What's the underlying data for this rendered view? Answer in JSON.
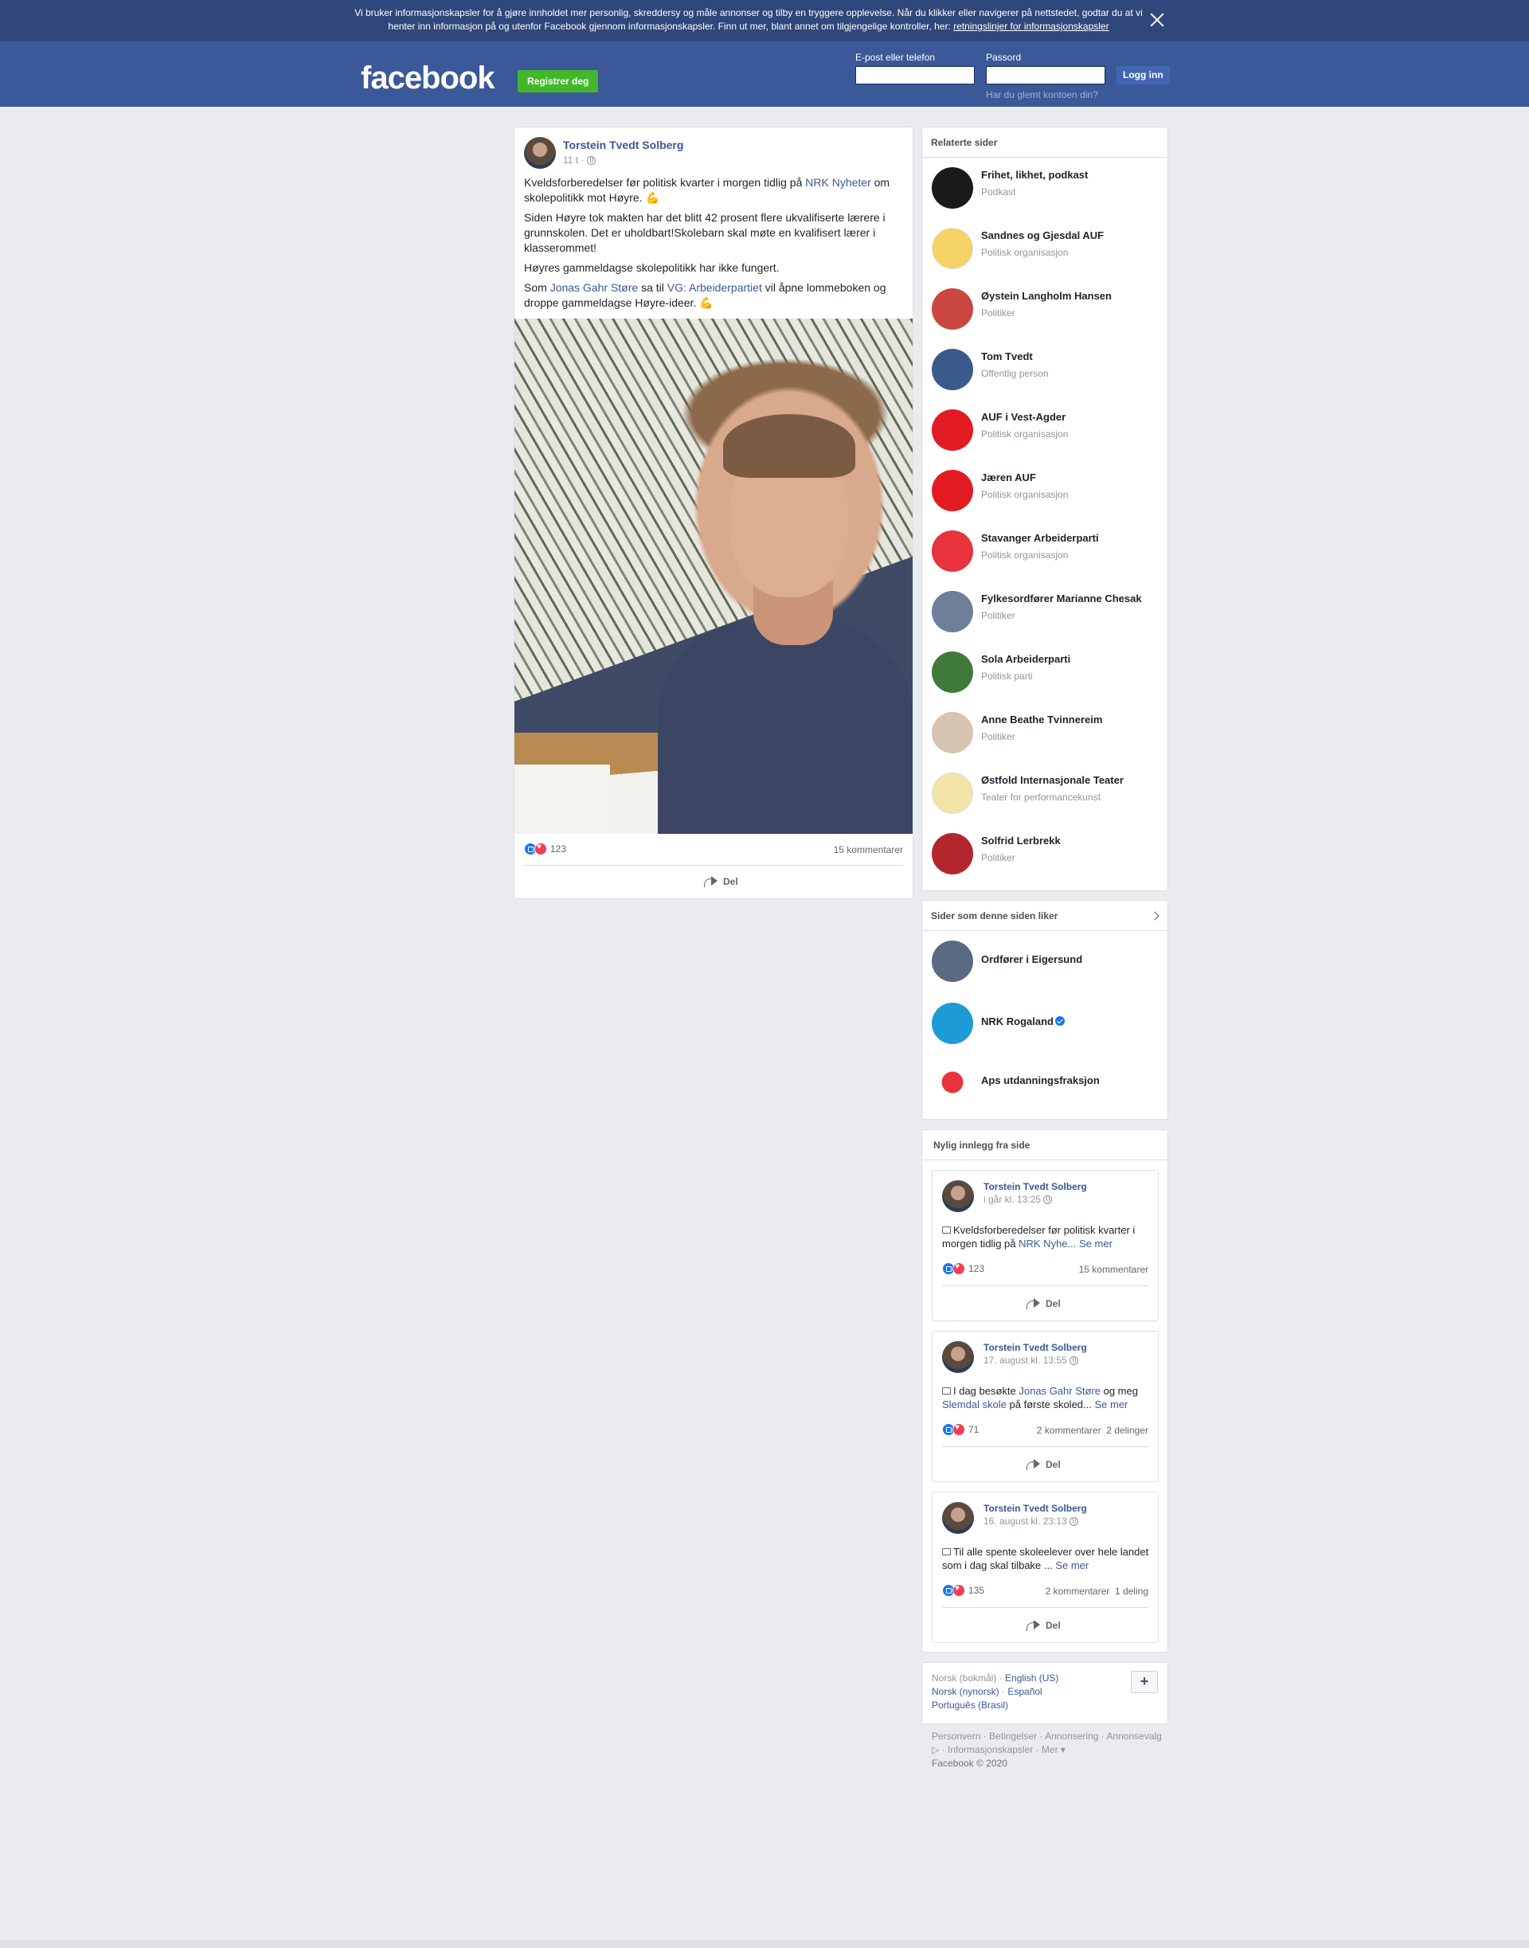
{
  "cookie_banner": {
    "text": "Vi bruker informasjonskapsler for å gjøre innholdet mer personlig, skreddersy og måle annonser og tilby en tryggere opplevelse. Når du klikker eller navigerer på nettstedet, godtar du at vi henter inn informasjon på og utenfor Facebook gjennom informasjonskapsler. Finn ut mer, blant annet om tilgjengelige kontroller, her: ",
    "link": "retningslinjer for informasjonskapsler"
  },
  "header": {
    "logo": "facebook",
    "register": "Registrer deg",
    "email_label": "E-post eller telefon",
    "password_label": "Passord",
    "login": "Logg inn",
    "forgot": "Har du glemt kontoen din?"
  },
  "post": {
    "author": "Torstein Tvedt Solberg",
    "time": "11 t ·",
    "p1_a": "Kveldsforberedelser før politisk kvarter i morgen tidlig på ",
    "p1_link": "NRK Nyheter",
    "p1_b": " om skolepolitikk mot Høyre. 💪",
    "p2": "Siden Høyre tok makten har det blitt 42 prosent flere ukvalifiserte lærere i grunnskolen. Det er uholdbart!Skolebarn skal møte en kvalifisert lærer i klasserommet!",
    "p3": "Høyres gammeldagse skolepolitikk har ikke fungert.",
    "p4_a": "Som ",
    "p4_link1": "Jonas Gahr Støre",
    "p4_b": " sa til ",
    "p4_link2": "VG: Arbeiderpartiet",
    "p4_c": " vil åpne lommeboken og droppe gammeldagse Høyre-ideer. 💪",
    "reactions": "123",
    "comments": "15 kommentarer",
    "share": "Del"
  },
  "related": {
    "title": "Relaterte sider",
    "items": [
      {
        "name": "Frihet, likhet, podkast",
        "category": "Podkast",
        "color": "#1a1a1a"
      },
      {
        "name": "Sandnes og Gjesdal AUF",
        "category": "Politisk organisasjon",
        "color": "#f6d365"
      },
      {
        "name": "Øystein Langholm Hansen",
        "category": "Politiker",
        "color": "#c9473f"
      },
      {
        "name": "Tom Tvedt",
        "category": "Offentlig person",
        "color": "#3b5a8c"
      },
      {
        "name": "AUF i Vest-Agder",
        "category": "Politisk organisasjon",
        "color": "#e21b23"
      },
      {
        "name": "Jæren AUF",
        "category": "Politisk organisasjon",
        "color": "#e21b23"
      },
      {
        "name": "Stavanger Arbeiderparti",
        "category": "Politisk organisasjon",
        "color": "#e8323c"
      },
      {
        "name": "Fylkesordfører Marianne Chesak",
        "category": "Politiker",
        "color": "#6d7f99"
      },
      {
        "name": "Sola Arbeiderparti",
        "category": "Politisk parti",
        "color": "#3f7a3a"
      },
      {
        "name": "Anne Beathe Tvinnereim",
        "category": "Politiker",
        "color": "#d6c3b0"
      },
      {
        "name": "Østfold Internasjonale Teater",
        "category": "Teater for performancekunst",
        "color": "#f3e3a6"
      },
      {
        "name": "Solfrid Lerbrekk",
        "category": "Politiker",
        "color": "#b3262e"
      }
    ]
  },
  "likes": {
    "title": "Sider som denne siden liker",
    "items": [
      {
        "name": "Ordfører i Eigersund",
        "color": "#5a6a80"
      },
      {
        "name": "NRK Rogaland",
        "color": "#1e9ad6"
      },
      {
        "name": "Aps utdanningsfraksjon",
        "color": "#ffffff"
      }
    ]
  },
  "recent": {
    "title": "Nylig innlegg fra side",
    "posts": [
      {
        "author": "Torstein Tvedt Solberg",
        "date": "i går kl. 13:25",
        "text_a": "Kveldsforberedelser før politisk kvarter i morgen tidlig på ",
        "link1": "NRK Nyhe...",
        "text_b": " ",
        "link2": "",
        "text_c": "",
        "more": "Se mer",
        "reactions": "123",
        "comments": "15 kommentarer",
        "shares": "",
        "share": "Del"
      },
      {
        "author": "Torstein Tvedt Solberg",
        "date": "17. august kl. 13:55",
        "text_a": "I dag besøkte ",
        "link1": "Jonas Gahr Støre",
        "text_b": " og meg ",
        "link2": "Slemdal skole",
        "text_c": " på første skoled... ",
        "more": "Se mer",
        "reactions": "71",
        "comments": "2 kommentarer",
        "shares": "2 delinger",
        "share": "Del"
      },
      {
        "author": "Torstein Tvedt Solberg",
        "date": "16. august kl. 23:13",
        "text_a": "Til alle spente skoleelever over hele landet som i dag skal tilbake ... ",
        "link1": "",
        "text_b": "",
        "link2": "",
        "text_c": "",
        "more": "Se mer",
        "reactions": "135",
        "comments": "2 kommentarer",
        "shares": "1 deling",
        "share": "Del"
      }
    ]
  },
  "languages": {
    "current": "Norsk (bokmål)",
    "sep": " · ",
    "en": "English (US)",
    "nn": "Norsk (nynorsk)",
    "es": "Español",
    "pt": "Português (Brasil)",
    "plus": "+"
  },
  "footer": {
    "links": "Personvern · Betingelser · Annonsering · Annonsevalg ▷ · Informasjonskapsler · Mer ▾",
    "copyright": "Facebook © 2020"
  }
}
